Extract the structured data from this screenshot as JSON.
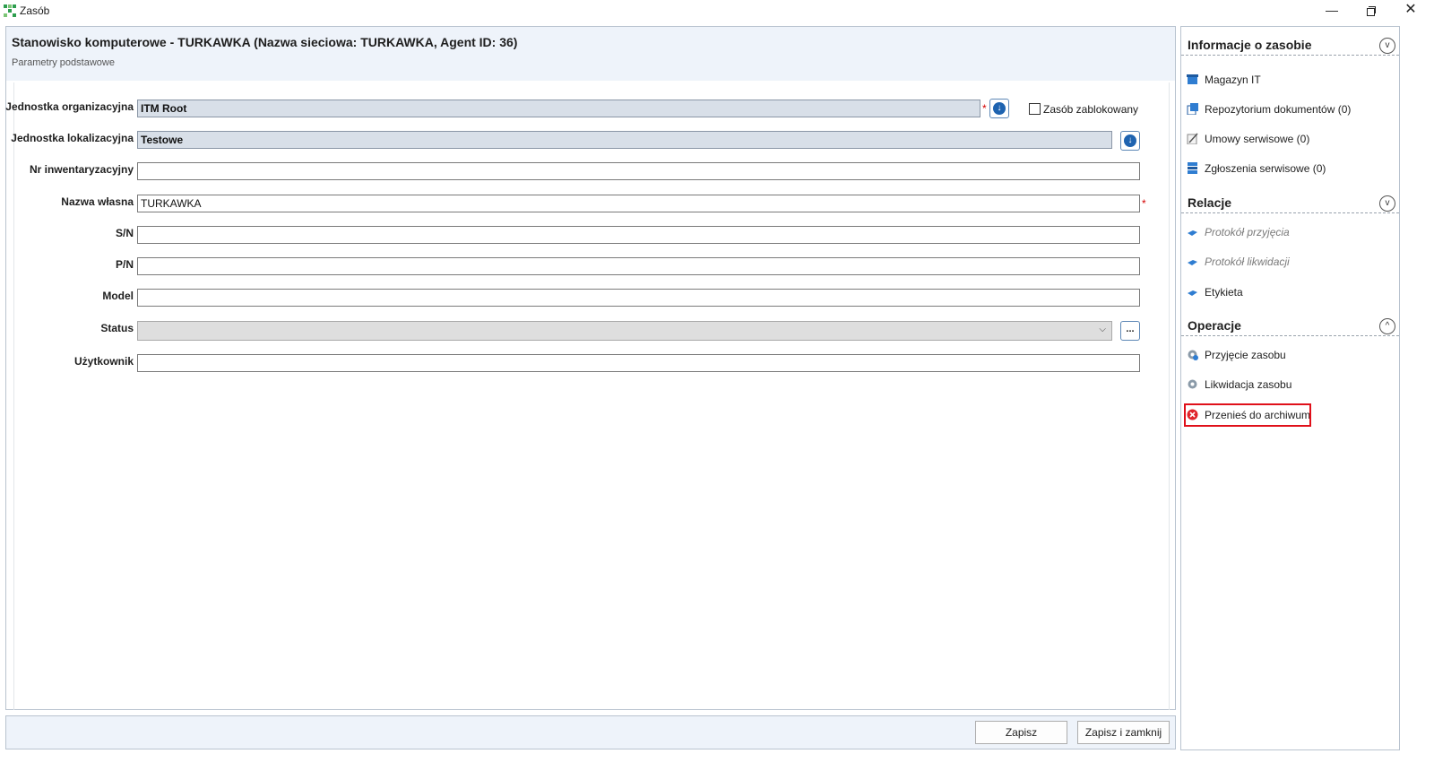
{
  "window": {
    "title": "Zasób",
    "controls": {
      "minimize": "—",
      "close": "✕"
    }
  },
  "header": {
    "title": "Stanowisko komputerowe - TURKAWKA (Nazwa sieciowa: TURKAWKA, Agent ID: 36)",
    "subtitle": "Parametry podstawowe"
  },
  "form": {
    "fields": {
      "org_unit": {
        "label": "Jednostka organizacyjna",
        "value": "ITM Root"
      },
      "loc_unit": {
        "label": "Jednostka lokalizacyjna",
        "value": "Testowe"
      },
      "inventory_no": {
        "label": "Nr inwentaryzacyjny",
        "value": ""
      },
      "own_name": {
        "label": "Nazwa własna",
        "value": "TURKAWKA"
      },
      "sn": {
        "label": "S/N",
        "value": ""
      },
      "pn": {
        "label": "P/N",
        "value": ""
      },
      "model": {
        "label": "Model",
        "value": ""
      },
      "status": {
        "label": "Status",
        "value": ""
      },
      "user": {
        "label": "Użytkownik",
        "value": ""
      }
    },
    "required_mark": "*",
    "locked_checkbox": {
      "label": "Zasób zablokowany",
      "checked": false
    },
    "pick_glyph": "↓",
    "select_arrow": "⌵",
    "ellipsis_label": "..."
  },
  "footer": {
    "save_label": "Zapisz",
    "save_close_label": "Zapisz i zamknij"
  },
  "side": {
    "sections": {
      "info": {
        "title": "Informacje o zasobie",
        "toggle": "v"
      },
      "relations": {
        "title": "Relacje",
        "toggle": "v"
      },
      "operations": {
        "title": "Operacje",
        "toggle": "^"
      }
    },
    "info_items": [
      {
        "label": "Magazyn IT",
        "icon": "warehouse-icon"
      },
      {
        "label": "Repozytorium dokumentów (0)",
        "icon": "documents-icon"
      },
      {
        "label": "Umowy serwisowe (0)",
        "icon": "contract-icon"
      },
      {
        "label": "Zgłoszenia serwisowe (0)",
        "icon": "ticket-icon"
      }
    ],
    "relation_items": [
      {
        "label": "Protokół przyjęcia",
        "enabled": false,
        "icon": "protocol-icon"
      },
      {
        "label": "Protokół likwidacji",
        "enabled": false,
        "icon": "protocol-icon"
      },
      {
        "label": "Etykieta",
        "enabled": true,
        "icon": "label-icon"
      }
    ],
    "operation_items": [
      {
        "label": "Przyjęcie zasobu",
        "icon": "gear-icon"
      },
      {
        "label": "Likwidacja zasobu",
        "icon": "gear-icon"
      },
      {
        "label": "Przenieś do archiwum",
        "icon": "archive-error-icon",
        "highlighted": true
      }
    ]
  },
  "colors": {
    "accent": "#1e63b0",
    "highlight": "#e0101a",
    "header_bg": "#eef3fa"
  }
}
